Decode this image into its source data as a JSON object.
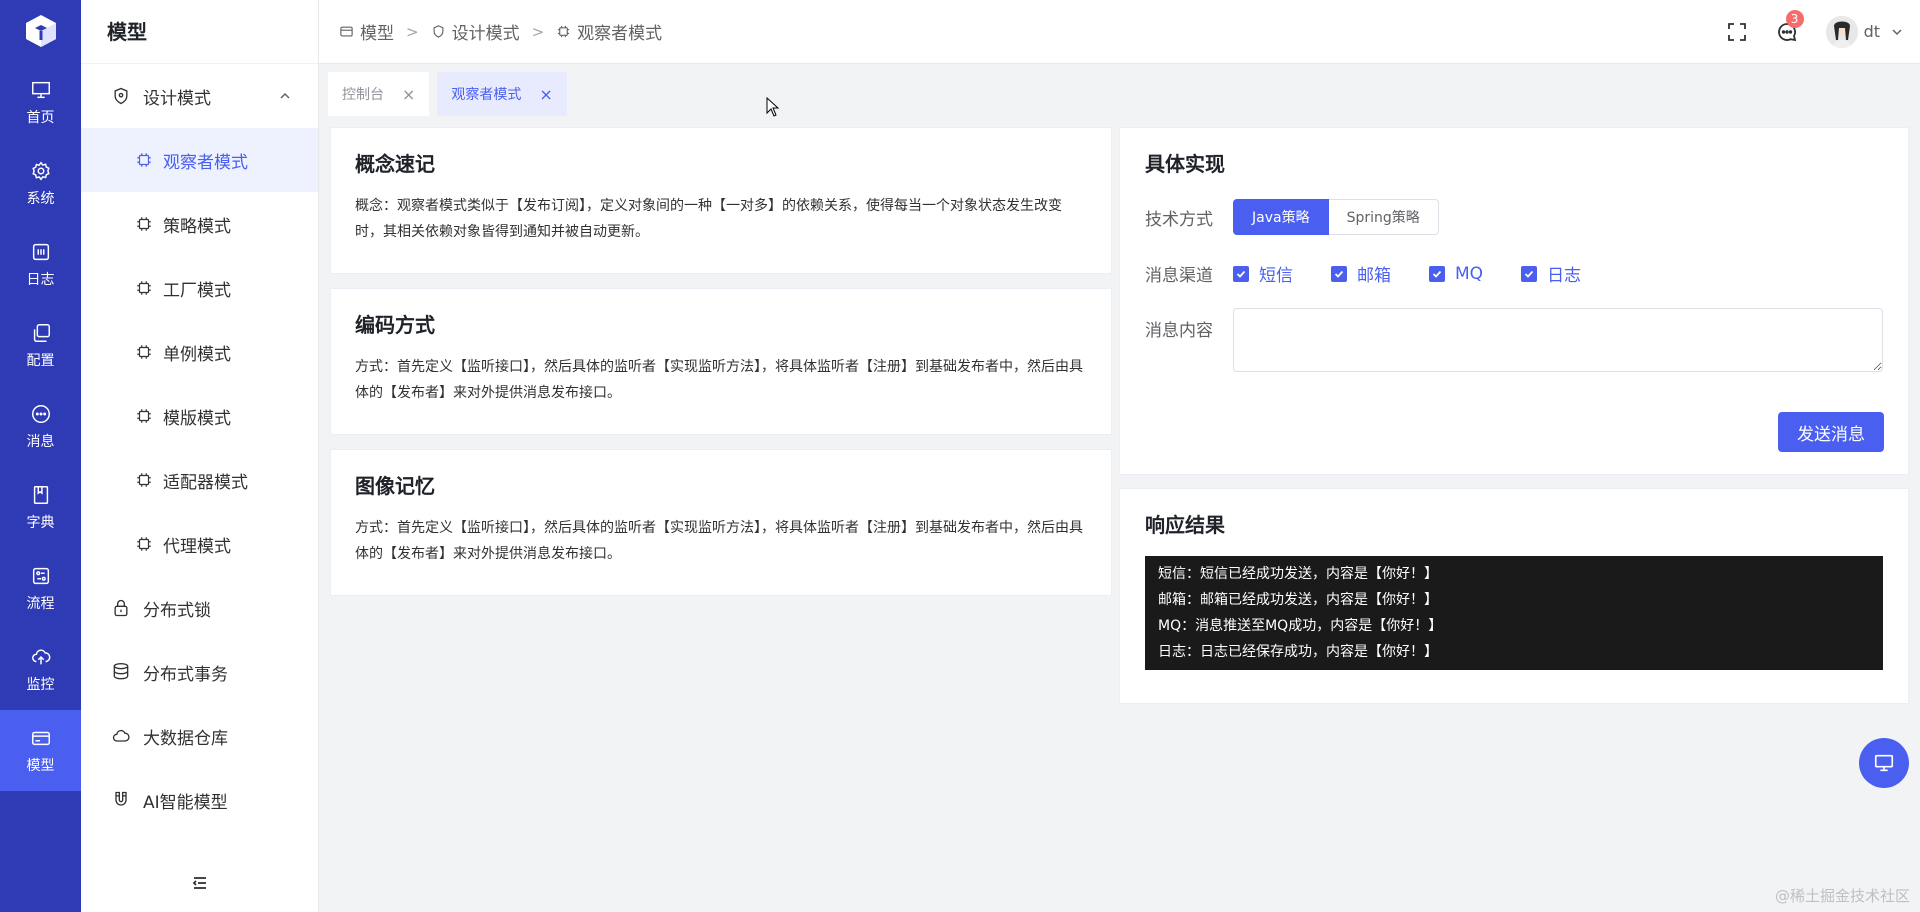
{
  "rail": {
    "items": [
      {
        "label": "首页",
        "icon": "monitor-icon"
      },
      {
        "label": "系统",
        "icon": "gear-icon"
      },
      {
        "label": "日志",
        "icon": "log-icon"
      },
      {
        "label": "配置",
        "icon": "copy-icon"
      },
      {
        "label": "消息",
        "icon": "chat-icon"
      },
      {
        "label": "字典",
        "icon": "book-icon"
      },
      {
        "label": "流程",
        "icon": "flow-icon"
      },
      {
        "label": "监控",
        "icon": "cloud-upload-icon"
      },
      {
        "label": "模型",
        "icon": "card-icon"
      }
    ],
    "active": "模型"
  },
  "sidebar": {
    "title": "模型",
    "group_design": "设计模式",
    "sub_items": [
      "观察者模式",
      "策略模式",
      "工厂模式",
      "单例模式",
      "模版模式",
      "适配器模式",
      "代理模式"
    ],
    "active_sub": "观察者模式",
    "groups": [
      "分布式锁",
      "分布式事务",
      "大数据仓库",
      "AI智能模型"
    ]
  },
  "header": {
    "crumbs": [
      "模型",
      "设计模式",
      "观察者模式"
    ],
    "badge_count": "3",
    "user": "dt"
  },
  "tabs": [
    {
      "label": "控制台"
    },
    {
      "label": "观察者模式"
    }
  ],
  "cards": {
    "concept": {
      "title": "概念速记",
      "text": "概念：观察者模式类似于【发布订阅】，定义对象间的一种【一对多】的依赖关系，使得每当一个对象状态发生改变时，其相关依赖对象皆得到通知并被自动更新。"
    },
    "coding": {
      "title": "编码方式",
      "text": "方式：首先定义【监听接口】，然后具体的监听者【实现监听方法】，将具体监听者【注册】到基础发布者中，然后由具体的【发布者】来对外提供消息发布接口。"
    },
    "image": {
      "title": "图像记忆",
      "text": "方式：首先定义【监听接口】，然后具体的监听者【实现监听方法】，将具体监听者【注册】到基础发布者中，然后由具体的【发布者】来对外提供消息发布接口。"
    },
    "impl": {
      "title": "具体实现",
      "tech_label": "技术方式",
      "tech_options": [
        "Java策略",
        "Spring策略"
      ],
      "tech_selected": "Java策略",
      "channel_label": "消息渠道",
      "channels": [
        "短信",
        "邮箱",
        "MQ",
        "日志"
      ],
      "content_label": "消息内容",
      "content_value": "",
      "send_label": "发送消息"
    },
    "result": {
      "title": "响应结果",
      "lines": [
        "短信：短信已经成功发送，内容是【你好！】",
        "邮箱：邮箱已经成功发送，内容是【你好！】",
        "MQ：消息推送至MQ成功，内容是【你好！】",
        "日志：日志已经保存成功，内容是【你好！】"
      ]
    }
  },
  "watermark": "@稀土掘金技术社区",
  "colors": {
    "rail": "#2f3bb5",
    "accent": "#4a5ff0",
    "badge": "#f56c6c"
  }
}
